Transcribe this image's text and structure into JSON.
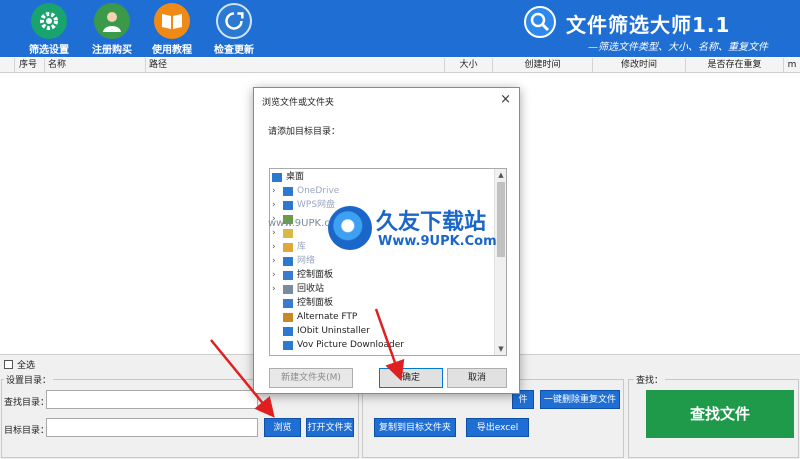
{
  "toolbar": {
    "filter_settings": "筛选设置",
    "register": "注册购买",
    "tutorial": "使用教程",
    "check_update": "检查更新"
  },
  "brand": {
    "title": "文件筛选大师1.1",
    "subtitle": "—筛选文件类型、大小、名称、重复文件"
  },
  "table": {
    "columns": [
      "序号",
      "名称",
      "路径",
      "大小",
      "创建时间",
      "修改时间",
      "是否存在重复",
      "m"
    ]
  },
  "bottom": {
    "select_all": "全选",
    "settings_label": "设置目录：",
    "search_dir_label": "查找目录：",
    "target_dir_label": "目标目录：",
    "search_dir_value": "",
    "target_dir_value": "",
    "browse": "浏览",
    "open_folder": "打开文件夹",
    "copy_to_target": "复制到目标文件夹",
    "export_excel": "导出excel",
    "partial_btn": "件",
    "remove_duplicates": "一键删除重复文件",
    "find_label": "查找：",
    "find_files": "查找文件"
  },
  "dialog": {
    "title": "浏览文件或文件夹",
    "close": "×",
    "prompt": "请添加目标目录：",
    "tree": [
      {
        "label": "桌面",
        "expand": false,
        "faded": false
      },
      {
        "label": "OneDrive",
        "expand": true,
        "faded": true
      },
      {
        "label": "WPS网盘",
        "expand": true,
        "faded": true
      },
      {
        "label": "",
        "expand": true,
        "faded": true
      },
      {
        "label": "",
        "expand": true,
        "faded": true
      },
      {
        "label": "库",
        "expand": true,
        "faded": true
      },
      {
        "label": "网络",
        "expand": true,
        "faded": true
      },
      {
        "label": "控制面板",
        "expand": true,
        "faded": false
      },
      {
        "label": "回收站",
        "expand": true,
        "faded": false
      },
      {
        "label": "控制面板",
        "expand": false,
        "faded": false
      },
      {
        "label": "Alternate FTP",
        "expand": false,
        "faded": false
      },
      {
        "label": "IObit Uninstaller",
        "expand": false,
        "faded": false
      },
      {
        "label": "Vov Picture Downloader",
        "expand": false,
        "faded": false
      }
    ],
    "new_folder": "新建文件夹(M)",
    "ok": "确定",
    "cancel": "取消"
  },
  "watermark": {
    "left": "www.9UPK.com",
    "big": "久友下载站",
    "url": "Www.9UPK.Com"
  }
}
